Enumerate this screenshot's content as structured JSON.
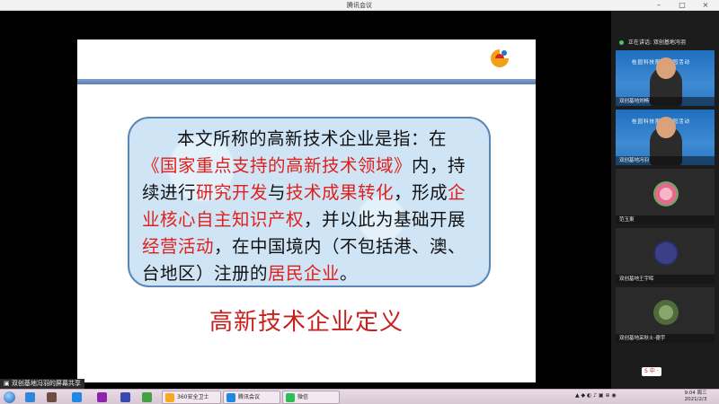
{
  "window": {
    "title": "腾讯会议"
  },
  "slide": {
    "paragraph": [
      {
        "t": "本文所称的高新技术企业是指：在",
        "c": ""
      },
      {
        "t": "《国家重点支持的高新技术领域》",
        "c": "red"
      },
      {
        "t": "内，持续进行",
        "c": ""
      },
      {
        "t": "研究开发",
        "c": "red"
      },
      {
        "t": "与",
        "c": ""
      },
      {
        "t": "技术成果转化",
        "c": "red"
      },
      {
        "t": "，形成",
        "c": ""
      },
      {
        "t": "企业核心自主知识产权",
        "c": "red"
      },
      {
        "t": "，并以此为基础开展",
        "c": ""
      },
      {
        "t": "经营活动",
        "c": "red"
      },
      {
        "t": "，在中国境内（不包括港、澳、台地区）注册的",
        "c": ""
      },
      {
        "t": "居民企业",
        "c": "red"
      },
      {
        "t": "。",
        "c": ""
      }
    ],
    "title": "高新技术企业定义"
  },
  "share_label": "双创基地冯羽的屏幕共享",
  "panel": {
    "speaking": "正在讲话: 双创基地冯羽",
    "tiles": [
      {
        "name": "双创基地刘畅",
        "banner": "桂园科技服务进园活动",
        "kind": "video"
      },
      {
        "name": "双创基地冯羽",
        "banner": "桂园科技服务进园活动",
        "kind": "video"
      },
      {
        "name": "范玉東",
        "banner": "",
        "kind": "rose"
      },
      {
        "name": "双创基地王宇晖",
        "banner": "",
        "kind": "logo"
      },
      {
        "name": "双创基地采秋士·德宇",
        "banner": "",
        "kind": "photo"
      }
    ]
  },
  "taskbar": {
    "buttons": [
      "360安全卫士",
      "腾讯会议",
      "微信"
    ],
    "time": "9:04 周三",
    "date": "2021/2/3",
    "ime": "S 中 ·"
  },
  "colors": {
    "accent_red": "#e0201c",
    "callout_bg": "#cfe4f5",
    "taskbar": "#e8dbe6"
  }
}
